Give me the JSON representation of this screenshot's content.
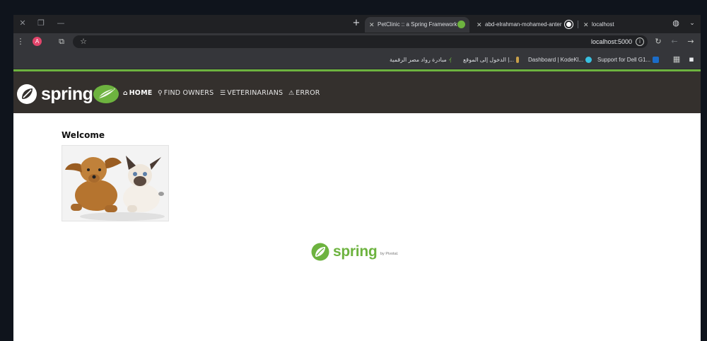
{
  "browser": {
    "tabs": [
      {
        "title": "PetClinic :: a Spring Framework",
        "active": true
      },
      {
        "title": "abd-elrahman-mohamed-anter",
        "active": false
      },
      {
        "title": "localhost",
        "active": false
      }
    ],
    "new_tab_label": "+",
    "profile_initial": "A",
    "url": "localhost:5000",
    "bookmarks": [
      {
        "label": "Support for Dell G1...",
        "icon": "dell-icon"
      },
      {
        "label": "Dashboard | KodeKl...",
        "icon": "kodekloud-icon"
      },
      {
        "label": "الدخول إلى الموقع |...",
        "icon": "site-icon"
      },
      {
        "label": "مبادرة رواد مصر الرقمية",
        "icon": "leaf-icon"
      }
    ]
  },
  "app": {
    "brand": "spring",
    "nav": [
      {
        "label": "HOME",
        "icon": "home-icon",
        "active": true
      },
      {
        "label": "FIND OWNERS",
        "icon": "search-icon",
        "active": false
      },
      {
        "label": "VETERINARIANS",
        "icon": "list-icon",
        "active": false
      },
      {
        "label": "ERROR",
        "icon": "warning-icon",
        "active": false
      }
    ],
    "heading": "Welcome",
    "footer_brand": "spring",
    "footer_by": "by Pivotal."
  },
  "colors": {
    "spring_green": "#6db33f",
    "navbar_bg": "#34302d",
    "browser_dark": "#202124",
    "browser_toolbar": "#35363a"
  }
}
